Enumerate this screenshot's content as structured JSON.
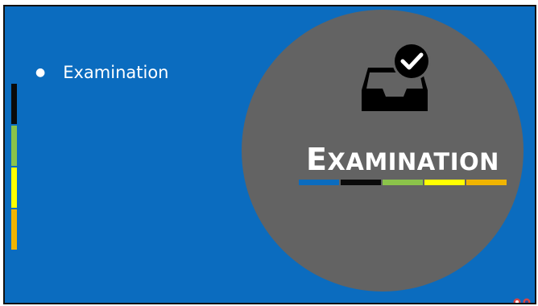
{
  "bullets": [
    "Examination"
  ],
  "title": {
    "first_letter": "E",
    "rest": "XAMINATION"
  },
  "icon": "inbox-tray-check-icon",
  "colors": {
    "background": "#0b6cbf",
    "circle": "#636363",
    "side_bars": [
      "#0a0a0a",
      "#8bc34a",
      "#ffff00",
      "#f0b400"
    ],
    "strip": [
      "#0b6cbf",
      "#0a0a0a",
      "#8bc34a",
      "#ffff00",
      "#f0b400"
    ]
  }
}
